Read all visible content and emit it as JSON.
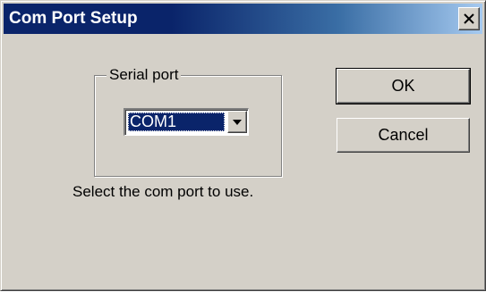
{
  "window": {
    "title": "Com Port Setup",
    "close_glyph": "✕"
  },
  "serial_port": {
    "group_label": "Serial port",
    "selected": "COM1"
  },
  "buttons": {
    "ok": "OK",
    "cancel": "Cancel"
  },
  "message": "Select the com port to use.",
  "colors": {
    "titlebar_start": "#0a246a",
    "titlebar_end": "#a6caf0",
    "face": "#d4d0c8",
    "selection": "#0a246a"
  },
  "icons": {
    "close": "close-icon",
    "dropdown": "chevron-down-icon"
  }
}
